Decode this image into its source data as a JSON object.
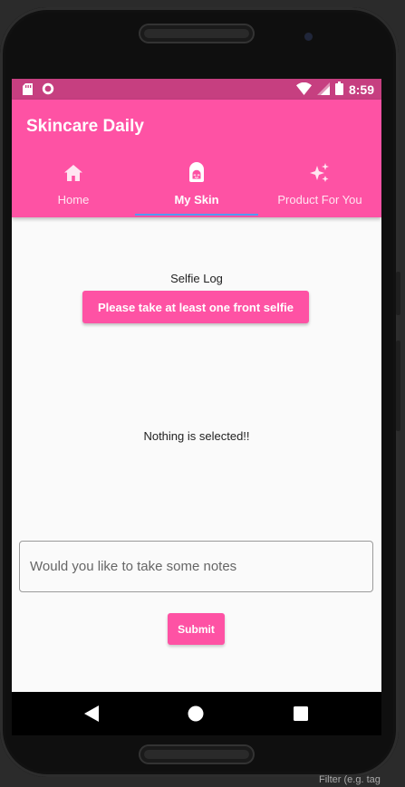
{
  "status_bar": {
    "time": "8:59",
    "icons": [
      "sd-card-icon",
      "record-icon",
      "wifi-icon",
      "signal-icon",
      "battery-icon"
    ]
  },
  "app_bar": {
    "title": "Skincare Daily"
  },
  "tabs": [
    {
      "label": "Home",
      "icon": "home-icon",
      "active": false
    },
    {
      "label": "My Skin",
      "icon": "face-icon",
      "active": true
    },
    {
      "label": "Product For You",
      "icon": "sparkles-icon",
      "active": false
    }
  ],
  "content": {
    "selfie_log_label": "Selfie Log",
    "selfie_button_label": "Please take at least one front selfie",
    "empty_message": "Nothing is selected!!",
    "notes_placeholder": "Would you like to take some notes",
    "notes_value": "",
    "submit_label": "Submit"
  },
  "system_nav": [
    "back-icon",
    "home-circle-icon",
    "recents-icon"
  ],
  "ide": {
    "filter_hint": "Filter (e.g. tag"
  },
  "colors": {
    "accent": "#fe52a4",
    "status_bar": "#c63f80",
    "tab_indicator": "#4f9cf0",
    "background": "#fafafa"
  }
}
